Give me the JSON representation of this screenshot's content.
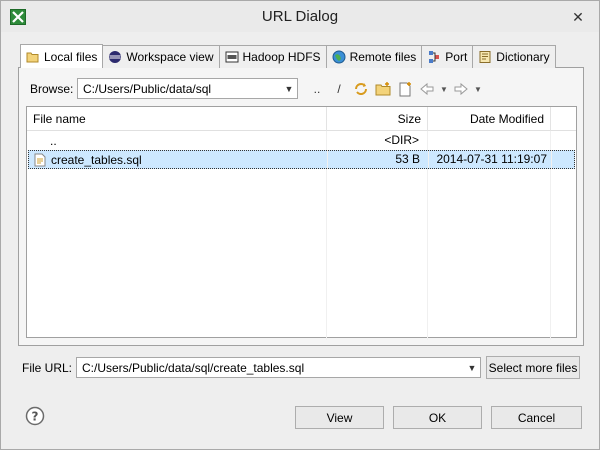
{
  "window": {
    "title": "URL Dialog"
  },
  "tabs": [
    {
      "label": "Local files",
      "icon": "folder-icon"
    },
    {
      "label": "Workspace view",
      "icon": "eclipse-icon"
    },
    {
      "label": "Hadoop HDFS",
      "icon": "hdfs-icon"
    },
    {
      "label": "Remote files",
      "icon": "globe-icon"
    },
    {
      "label": "Port",
      "icon": "port-icon"
    },
    {
      "label": "Dictionary",
      "icon": "dictionary-icon"
    }
  ],
  "browse": {
    "label": "Browse:",
    "path": "C:/Users/Public/data/sql",
    "toolbar": {
      "up_dir": "..",
      "root": "/"
    }
  },
  "table": {
    "columns": {
      "name": "File name",
      "size": "Size",
      "date": "Date Modified"
    },
    "rows": [
      {
        "name": "..",
        "size": "<DIR>",
        "date": ""
      },
      {
        "name": "create_tables.sql",
        "size": "53 B",
        "date": "2014-07-31 11:19:07"
      }
    ]
  },
  "file_url": {
    "label": "File URL:",
    "value": "C:/Users/Public/data/sql/create_tables.sql"
  },
  "buttons": {
    "select_more": "Select more files",
    "view": "View",
    "ok": "OK",
    "cancel": "Cancel",
    "help": "?"
  },
  "colors": {
    "selection": "#cde8ff",
    "window_bg": "#eeeeee"
  }
}
